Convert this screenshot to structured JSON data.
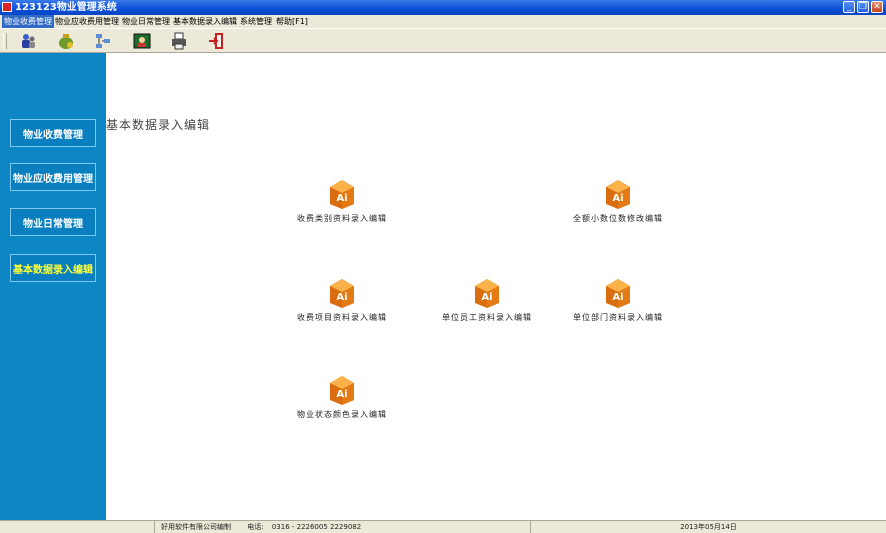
{
  "window": {
    "title": "123123物业管理系统",
    "controls": [
      "minimize-icon",
      "restore-icon",
      "close-icon"
    ]
  },
  "menu": {
    "items": [
      {
        "label": "物业收费管理",
        "active": true
      },
      {
        "label": "物业应收费用管理",
        "active": false
      },
      {
        "label": "物业日常管理",
        "active": false
      },
      {
        "label": "基本数据录入编辑",
        "active": false
      },
      {
        "label": "系统管理",
        "active": false
      },
      {
        "label": "帮助[F1]",
        "active": false
      }
    ]
  },
  "toolbar": {
    "icons": [
      "users-icon",
      "money-bag-icon",
      "network-icon",
      "picture-icon",
      "printer-icon",
      "exit-door-icon"
    ]
  },
  "sidebar": {
    "items": [
      {
        "label": "物业收费管理",
        "active": false
      },
      {
        "label": "物业应收费用管理",
        "active": false
      },
      {
        "label": "物业日常管理",
        "active": false
      },
      {
        "label": "基本数据录入编辑",
        "active": true
      }
    ]
  },
  "main": {
    "title": "基本数据录入编辑",
    "features": [
      {
        "label": "收费类别资料录入编辑",
        "icon": "ai-file-icon"
      },
      {
        "label": "全额小数位数修改编辑",
        "icon": "ai-file-icon"
      },
      {
        "label": "收费项目资料录入编辑",
        "icon": "ai-file-icon"
      },
      {
        "label": "单位员工资料录入编辑",
        "icon": "ai-file-icon"
      },
      {
        "label": "单位部门资料录入编辑",
        "icon": "ai-file-icon"
      },
      {
        "label": "物业状态颜色录入编辑",
        "icon": "ai-file-icon"
      }
    ]
  },
  "status": {
    "company": "好用软件有限公司编制",
    "phone_label": "电话:",
    "phone": "0316 - 2226005  2229082",
    "date": "2013年05月14日"
  },
  "colors": {
    "sidebar_bg": "#0d86c6",
    "sidebar_active_text": "#ffff33",
    "titlebar": "#0a4fd6",
    "icon_orange": "#f08a1c"
  }
}
